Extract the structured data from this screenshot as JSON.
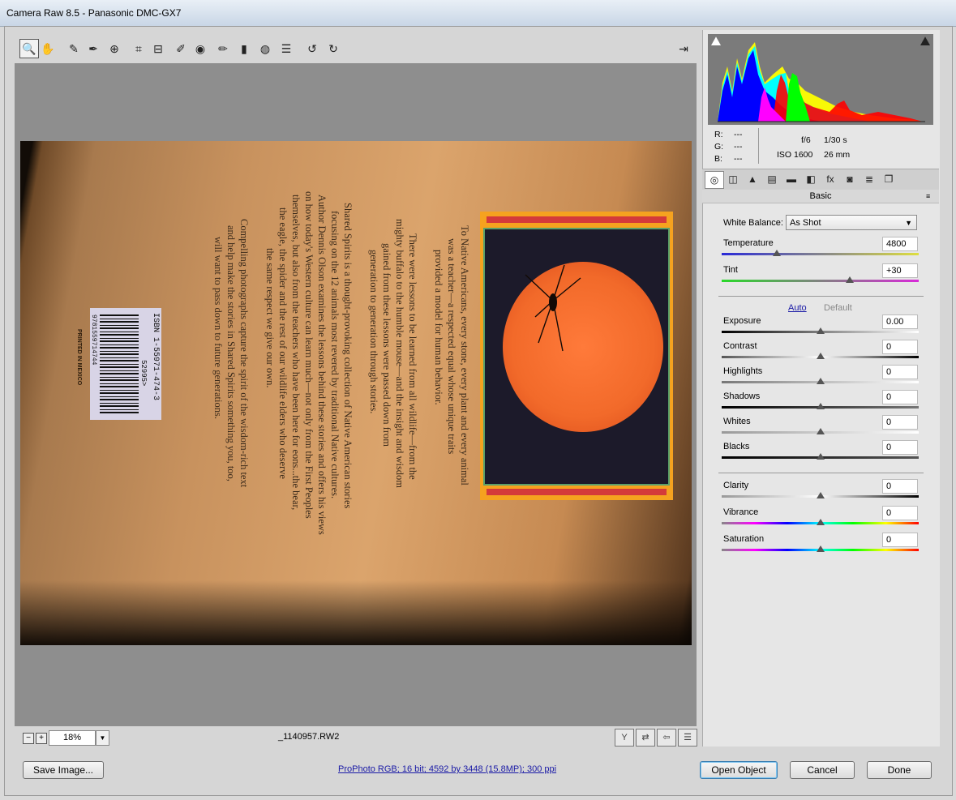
{
  "window": {
    "title": "Camera Raw 8.5  -  Panasonic DMC-GX7"
  },
  "toolbar": {
    "tools": [
      {
        "name": "zoom-tool-icon",
        "glyph": "🔍"
      },
      {
        "name": "hand-tool-icon",
        "glyph": "✋"
      },
      {
        "name": "white-balance-tool-icon",
        "glyph": "✎"
      },
      {
        "name": "color-sampler-tool-icon",
        "glyph": "✒"
      },
      {
        "name": "targeted-adjustment-tool-icon",
        "glyph": "⊕"
      },
      {
        "name": "crop-tool-icon",
        "glyph": "⌗"
      },
      {
        "name": "straighten-tool-icon",
        "glyph": "⊟"
      },
      {
        "name": "spot-removal-tool-icon",
        "glyph": "✐"
      },
      {
        "name": "red-eye-tool-icon",
        "glyph": "◉"
      },
      {
        "name": "adjustment-brush-icon",
        "glyph": "✏"
      },
      {
        "name": "graduated-filter-icon",
        "glyph": "▮"
      },
      {
        "name": "radial-filter-icon",
        "glyph": "◍"
      },
      {
        "name": "preferences-icon",
        "glyph": "☰"
      },
      {
        "name": "rotate-left-icon",
        "glyph": "↺"
      },
      {
        "name": "rotate-right-icon",
        "glyph": "↻"
      }
    ],
    "fullscreen_glyph": "⇥"
  },
  "photo": {
    "cover_text_1": "To Native Americans, every stone, every plant and every animal",
    "cover_text_2": "was a teacher—a respected equal whose unique traits",
    "cover_text_3": "provided a model for human behavior.",
    "cover_text_4": "There were lessons to be learned from all wildlife—from the",
    "cover_text_5": "mighty buffalo to the humble mouse—and the insight and wisdom",
    "cover_text_6": "gained from these lessons were passed down from",
    "cover_text_7": "generation to generation through stories.",
    "cover_text_8": "Shared Spirits is a thought-provoking collection of Native American stories",
    "cover_text_9": "focusing on the 12 animals most revered by traditional Native cultures.",
    "cover_text_10": "Author Dennis Olson examines the lessons behind these stories and offers his views",
    "cover_text_11": "on how today's Western culture can learn much—not only from the First Peoples",
    "cover_text_12": "themselves, but also from the teachers who have been here for eons...the bear,",
    "cover_text_13": "the eagle, the spider and the rest of our wildlife elders who deserve",
    "cover_text_14": "the same respect we give our own.",
    "cover_text_15": "Compelling photographs capture the spirit of the wisdom-rich text",
    "cover_text_16": "and help make the stories in Shared Spirits something you, too,",
    "cover_text_17": "will want to pass down to future generations.",
    "isbn": "ISBN 1-55971-474-3",
    "barcode_number": "9781559714744",
    "price_code": "52995>",
    "printed": "PRINTED IN MEXICO"
  },
  "statusbar": {
    "zoom_minus": "−",
    "zoom_plus": "+",
    "zoom_value": "18%",
    "zoom_dropdown": "▼",
    "filename": "_1140957.RW2"
  },
  "histogram": {
    "readout": {
      "r_label": "R:",
      "r_value": "---",
      "g_label": "G:",
      "g_value": "---",
      "b_label": "B:",
      "b_value": "---",
      "aperture": "f/6",
      "shutter": "1/30 s",
      "iso": "ISO 1600",
      "focal": "26 mm"
    }
  },
  "panel": {
    "tabs": [
      {
        "name": "tab-basic-icon",
        "glyph": "◎"
      },
      {
        "name": "tab-tone-curve-icon",
        "glyph": "◫"
      },
      {
        "name": "tab-detail-icon",
        "glyph": "▲"
      },
      {
        "name": "tab-hsl-icon",
        "glyph": "▤"
      },
      {
        "name": "tab-split-toning-icon",
        "glyph": "▬"
      },
      {
        "name": "tab-lens-icon",
        "glyph": "◧"
      },
      {
        "name": "tab-effects-icon",
        "glyph": "fx"
      },
      {
        "name": "tab-camera-calibration-icon",
        "glyph": "◙"
      },
      {
        "name": "tab-presets-icon",
        "glyph": "≣"
      },
      {
        "name": "tab-snapshots-icon",
        "glyph": "❐"
      }
    ],
    "section_title": "Basic",
    "white_balance_label": "White Balance:",
    "white_balance_value": "As Shot",
    "auto_label": "Auto",
    "default_label": "Default",
    "sliders": {
      "temperature": {
        "label": "Temperature",
        "value": "4800",
        "position": 0.28
      },
      "tint": {
        "label": "Tint",
        "value": "+30",
        "position": 0.65
      },
      "exposure": {
        "label": "Exposure",
        "value": "0.00",
        "position": 0.5
      },
      "contrast": {
        "label": "Contrast",
        "value": "0",
        "position": 0.5
      },
      "highlights": {
        "label": "Highlights",
        "value": "0",
        "position": 0.5
      },
      "shadows": {
        "label": "Shadows",
        "value": "0",
        "position": 0.5
      },
      "whites": {
        "label": "Whites",
        "value": "0",
        "position": 0.5
      },
      "blacks": {
        "label": "Blacks",
        "value": "0",
        "position": 0.5
      },
      "clarity": {
        "label": "Clarity",
        "value": "0",
        "position": 0.5
      },
      "vibrance": {
        "label": "Vibrance",
        "value": "0",
        "position": 0.5
      },
      "saturation": {
        "label": "Saturation",
        "value": "0",
        "position": 0.5
      }
    }
  },
  "footer": {
    "save_label": "Save Image...",
    "info_link": "ProPhoto RGB; 16 bit; 4592 by 3448 (15.8MP); 300 ppi",
    "open_label": "Open Object",
    "cancel_label": "Cancel",
    "done_label": "Done"
  }
}
